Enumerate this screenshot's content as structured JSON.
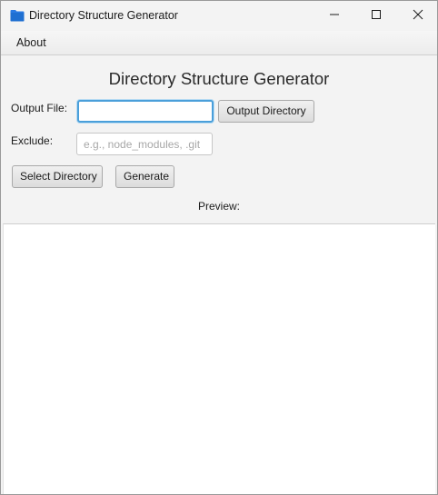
{
  "window": {
    "title": "Directory Structure Generator",
    "app_icon": "folder-dsg-icon",
    "controls": {
      "minimize_icon": "minimize-icon",
      "maximize_icon": "maximize-icon",
      "close_icon": "close-icon"
    }
  },
  "menubar": {
    "items": [
      {
        "label": "About"
      }
    ]
  },
  "main": {
    "heading": "Directory Structure Generator",
    "output_file": {
      "label": "Output File:",
      "value": "",
      "placeholder": ""
    },
    "output_directory_button": "Output Directory",
    "exclude": {
      "label": "Exclude:",
      "value": "",
      "placeholder": "e.g., node_modules, .git"
    },
    "select_directory_button": "Select Directory",
    "generate_button": "Generate",
    "preview_label": "Preview:",
    "preview_content": ""
  },
  "colors": {
    "window_bg": "#f3f3f3",
    "focus_accent": "#4a9fda",
    "icon_blue": "#1f6fd1"
  }
}
